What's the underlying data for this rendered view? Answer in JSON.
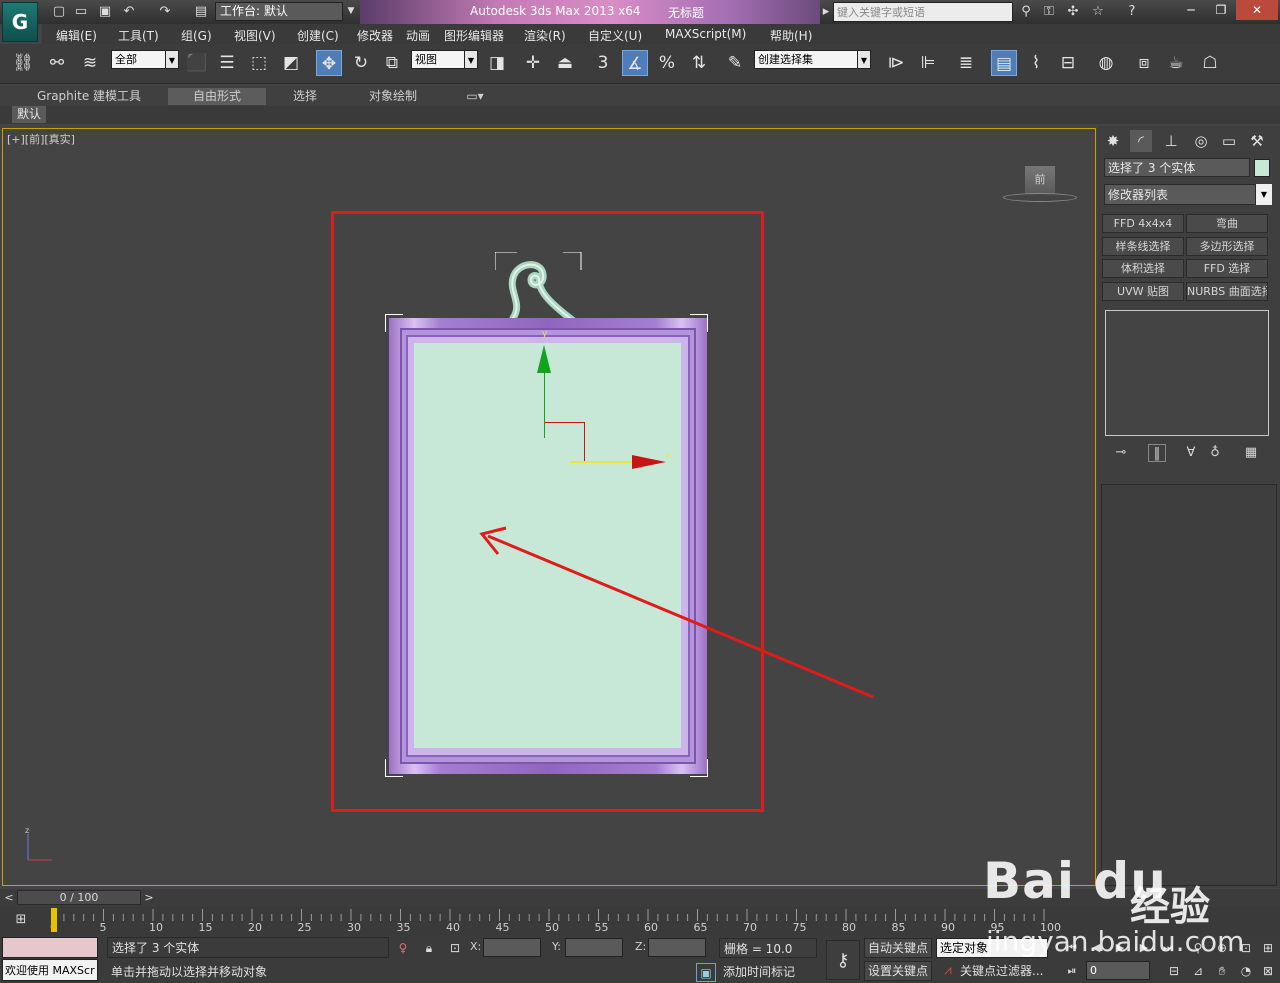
{
  "titlebar": {
    "workspace": "工作台: 默认",
    "app_title": "Autodesk 3ds Max  2013 x64",
    "doc_title": "无标题",
    "search_placeholder": "键入关键字或短语",
    "quick_access_icons": [
      "new-file-icon",
      "open-file-icon",
      "save-icon",
      "undo-icon",
      "redo-icon",
      "project-folder-icon"
    ]
  },
  "menu": [
    "编辑(E)",
    "工具(T)",
    "组(G)",
    "视图(V)",
    "创建(C)",
    "修改器",
    "动画",
    "图形编辑器",
    "渲染(R)",
    "自定义(U)",
    "MAXScript(M)",
    "帮助(H)"
  ],
  "toolbar": {
    "selection_filter": "全部",
    "ref_coord": "视图",
    "named_selection": "创建选择集",
    "snap_value": "3"
  },
  "ribbon": {
    "tabs": [
      "Graphite 建模工具",
      "自由形式",
      "选择",
      "对象绘制"
    ],
    "active_tab": "自由形式",
    "subtab": "默认"
  },
  "viewport": {
    "label": "[+][前][真实]",
    "viewcube_label": "前",
    "gizmo_x": "x",
    "gizmo_y": "y",
    "world_axis_z": "z"
  },
  "command_panel": {
    "selection_text": "选择了 3 个实体",
    "selection_color": "#c8e8d7",
    "modifier_list": "修改器列表",
    "modifier_buttons": [
      "FFD 4x4x4",
      "弯曲",
      "样条线选择",
      "多边形选择",
      "体积选择",
      "FFD 选择",
      "UVW 贴图",
      "NURBS 曲面选择"
    ]
  },
  "timeslider": {
    "position": "0 / 100",
    "prev": "<",
    "next": ">",
    "ticks": [
      "0",
      "5",
      "10",
      "15",
      "20",
      "25",
      "30",
      "35",
      "40",
      "45",
      "50",
      "55",
      "60",
      "65",
      "70",
      "75",
      "80",
      "85",
      "90",
      "95",
      "100"
    ]
  },
  "status": {
    "maxscript_welcome": "欢迎使用 MAXScr",
    "selection": "选择了 3 个实体",
    "prompt": "单击并拖动以选择并移动对象",
    "x_label": "X:",
    "y_label": "Y:",
    "z_label": "Z:",
    "grid": "栅格 = 10.0",
    "add_time_tag": "添加时间标记",
    "auto_key": "自动关键点",
    "set_key": "设置关键点",
    "selected_object": "选定对象",
    "key_filters": "关键点过滤器...",
    "current_frame": "0"
  },
  "watermark": {
    "brand": "Bai du",
    "brand_cn": "经验",
    "url": "jingyan.baidu.com"
  },
  "colors": {
    "selection_box": "#e01b1b",
    "frame_purple": "#a47fd0",
    "picture_mint": "#c8e8d7",
    "viewport_border": "#c8a100"
  }
}
